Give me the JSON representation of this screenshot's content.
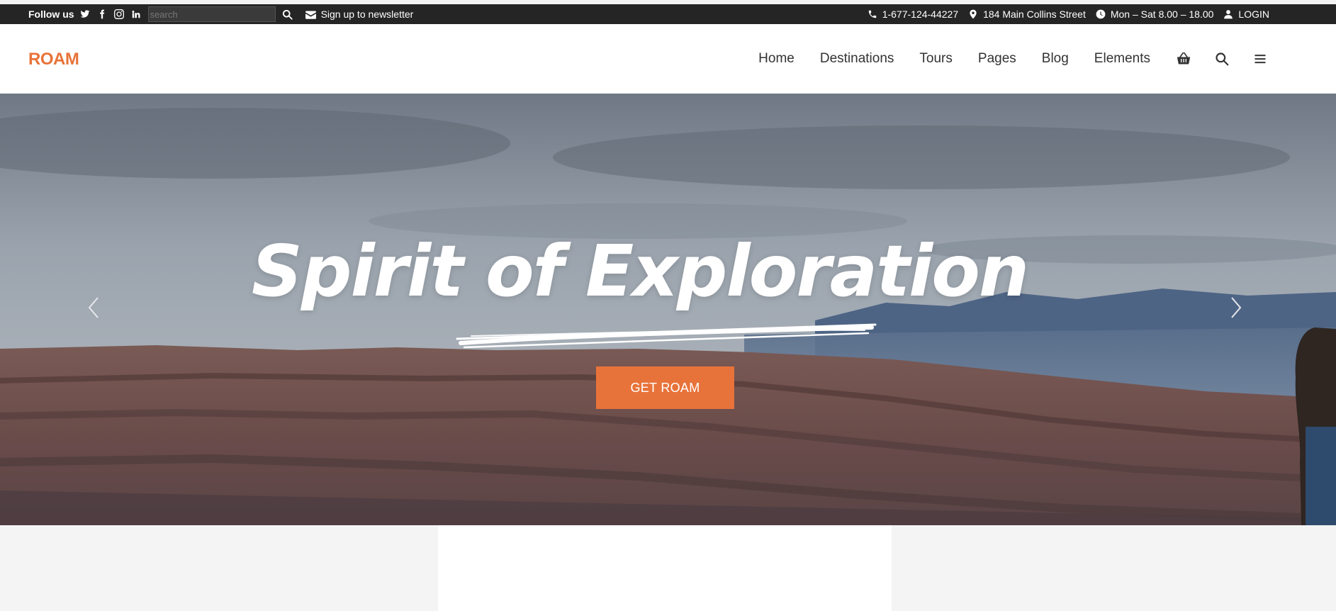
{
  "topbar": {
    "follow_label": "Follow us",
    "social": [
      {
        "icon": "twitter-icon"
      },
      {
        "icon": "facebook-icon"
      },
      {
        "icon": "instagram-icon"
      },
      {
        "icon": "linkedin-icon"
      }
    ],
    "search_placeholder": "search",
    "search_value": "",
    "newsletter_label": "Sign up to newsletter",
    "phone": "1-677-124-44227",
    "address": "184 Main Collins Street",
    "hours": "Mon – Sat 8.00 – 18.00",
    "login_label": "LOGIN"
  },
  "header": {
    "logo": "ROAM",
    "nav": [
      "Home",
      "Destinations",
      "Tours",
      "Pages",
      "Blog",
      "Elements"
    ],
    "icons": [
      "basket-icon",
      "search-icon",
      "menu-icon"
    ]
  },
  "hero": {
    "title": "Spirit of Exploration",
    "cta_label": "GET ROAM"
  },
  "colors": {
    "accent": "#e8733a",
    "topbar_bg": "#252525",
    "text_dark": "#333333"
  }
}
